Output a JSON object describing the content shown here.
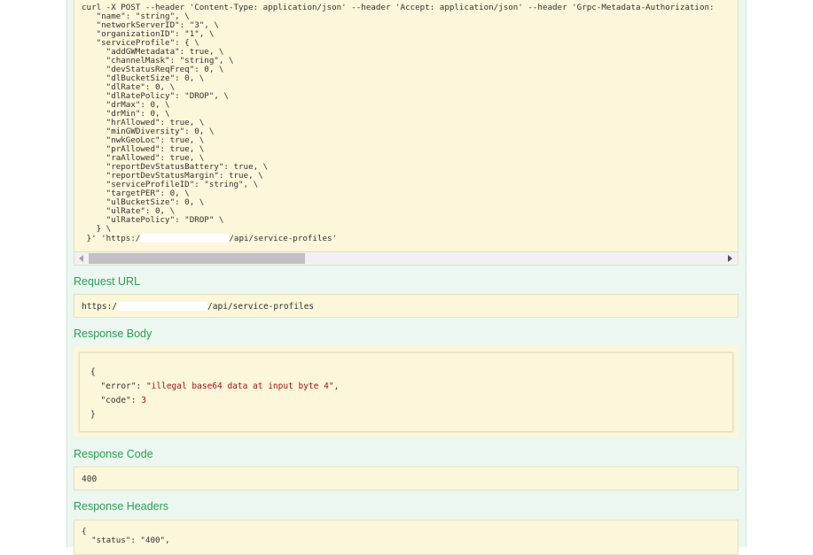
{
  "curl": {
    "lines": [
      "curl -X POST --header 'Content-Type: application/json' --header 'Accept: application/json' --header 'Grpc-Metadata-Authorization: ",
      "   \"name\": \"string\", \\",
      "   \"networkServerID\": \"3\", \\",
      "   \"organizationID\": \"1\", \\",
      "   \"serviceProfile\": { \\",
      "     \"addGWMetadata\": true, \\",
      "     \"channelMask\": \"string\", \\",
      "     \"devStatusReqFreq\": 0, \\",
      "     \"dlBucketSize\": 0, \\",
      "     \"dlRate\": 0, \\",
      "     \"dlRatePolicy\": \"DROP\", \\",
      "     \"drMax\": 0, \\",
      "     \"drMin\": 0, \\",
      "     \"hrAllowed\": true, \\",
      "     \"minGWDiversity\": 0, \\",
      "     \"nwkGeoLoc\": true, \\",
      "     \"prAllowed\": true, \\",
      "     \"raAllowed\": true, \\",
      "     \"reportDevStatusBattery\": true, \\",
      "     \"reportDevStatusMargin\": true, \\",
      "     \"serviceProfileID\": \"string\", \\",
      "     \"targetPER\": 0, \\",
      "     \"ulBucketSize\": 0, \\",
      "     \"ulRate\": 0, \\",
      "     \"ulRatePolicy\": \"DROP\" \\",
      "   } \\"
    ],
    "last_line_prefix": " }' 'https:/",
    "last_line_suffix": "/api/service-profiles'"
  },
  "request_url": {
    "title": "Request URL",
    "prefix": "https:/",
    "suffix": "/api/service-profiles"
  },
  "response_body": {
    "title": "Response Body",
    "open": "{",
    "error_key": "\"error\": ",
    "error_value": "\"illegal base64 data at input byte 4\"",
    "code_key": "\"code\": ",
    "code_value": "3",
    "close": "}"
  },
  "response_code": {
    "title": "Response Code",
    "value": "400"
  },
  "response_headers": {
    "title": "Response Headers",
    "lines": [
      "{",
      "  \"status\": \"400\","
    ]
  },
  "colors": {
    "panel_bg": "#ebf7f0",
    "code_bg": "#fcf6db",
    "title_green": "#2e9e52",
    "string_red": "#a11"
  }
}
